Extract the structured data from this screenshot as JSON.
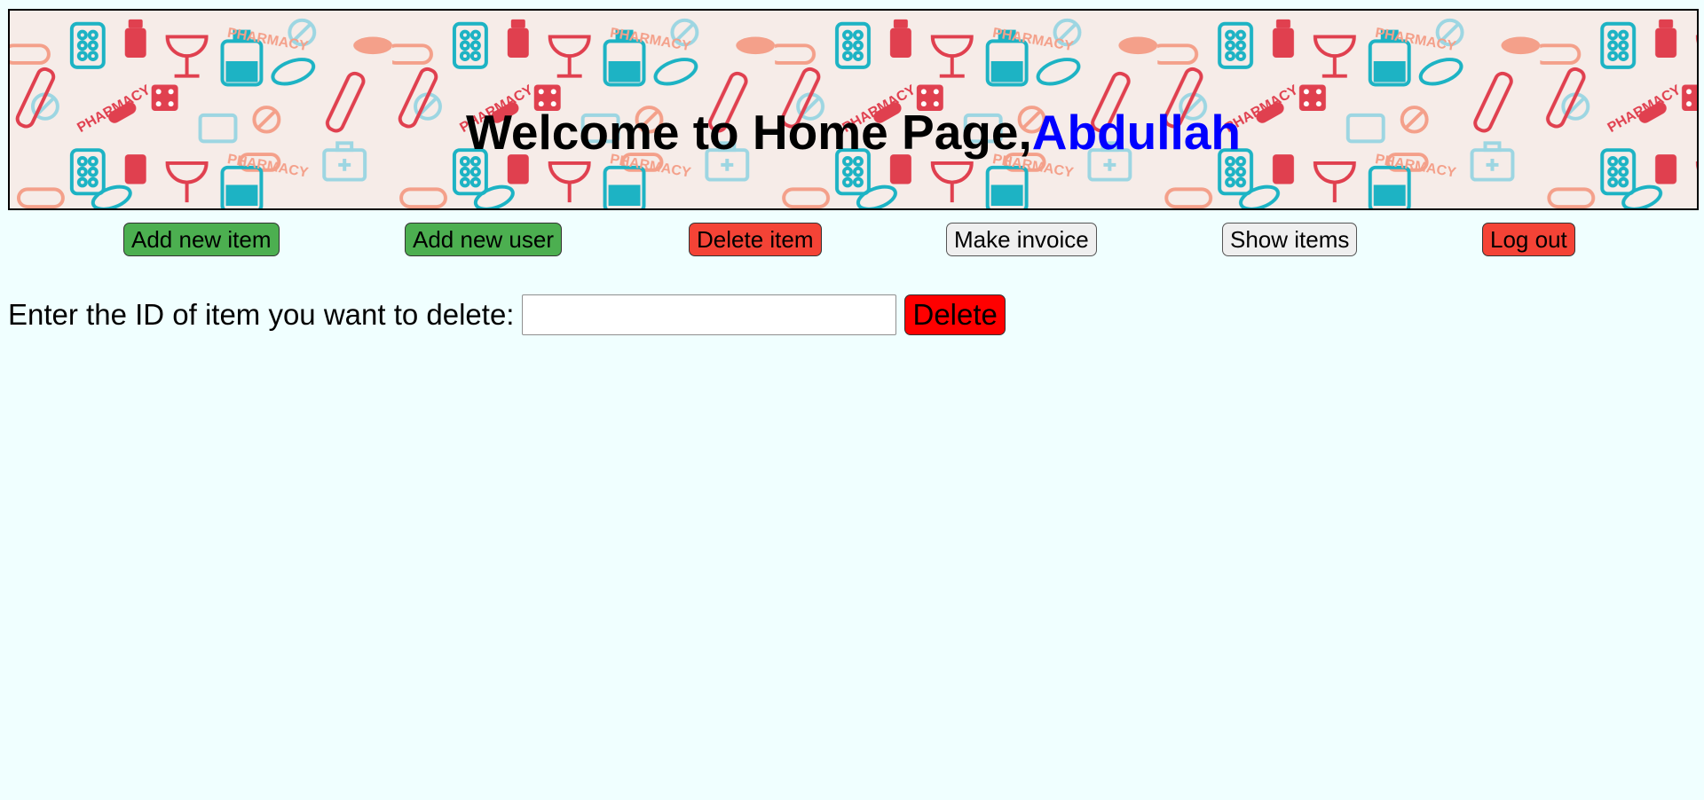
{
  "banner": {
    "title_prefix": "Welcome to Home Page,",
    "username": "Abdullah",
    "pattern_word": "PHARMACY"
  },
  "nav": {
    "add_item": "Add new item",
    "add_user": "Add new user",
    "delete_item": "Delete item",
    "make_invoice": "Make invoice",
    "show_items": "Show items",
    "log_out": "Log out"
  },
  "delete_form": {
    "label": "Enter the ID of item you want to delete:",
    "input_value": "",
    "submit_label": "Delete"
  },
  "colors": {
    "page_bg": "#F0FFFF",
    "username": "#0000FF",
    "green_button": "#4CAF50",
    "red_button": "#F44336",
    "delete_button": "#FF0000",
    "pattern_red": "#E0404F",
    "pattern_teal": "#1DB3C4",
    "pattern_salmon": "#F4A08A",
    "pattern_lightblue": "#9DD6E2"
  }
}
